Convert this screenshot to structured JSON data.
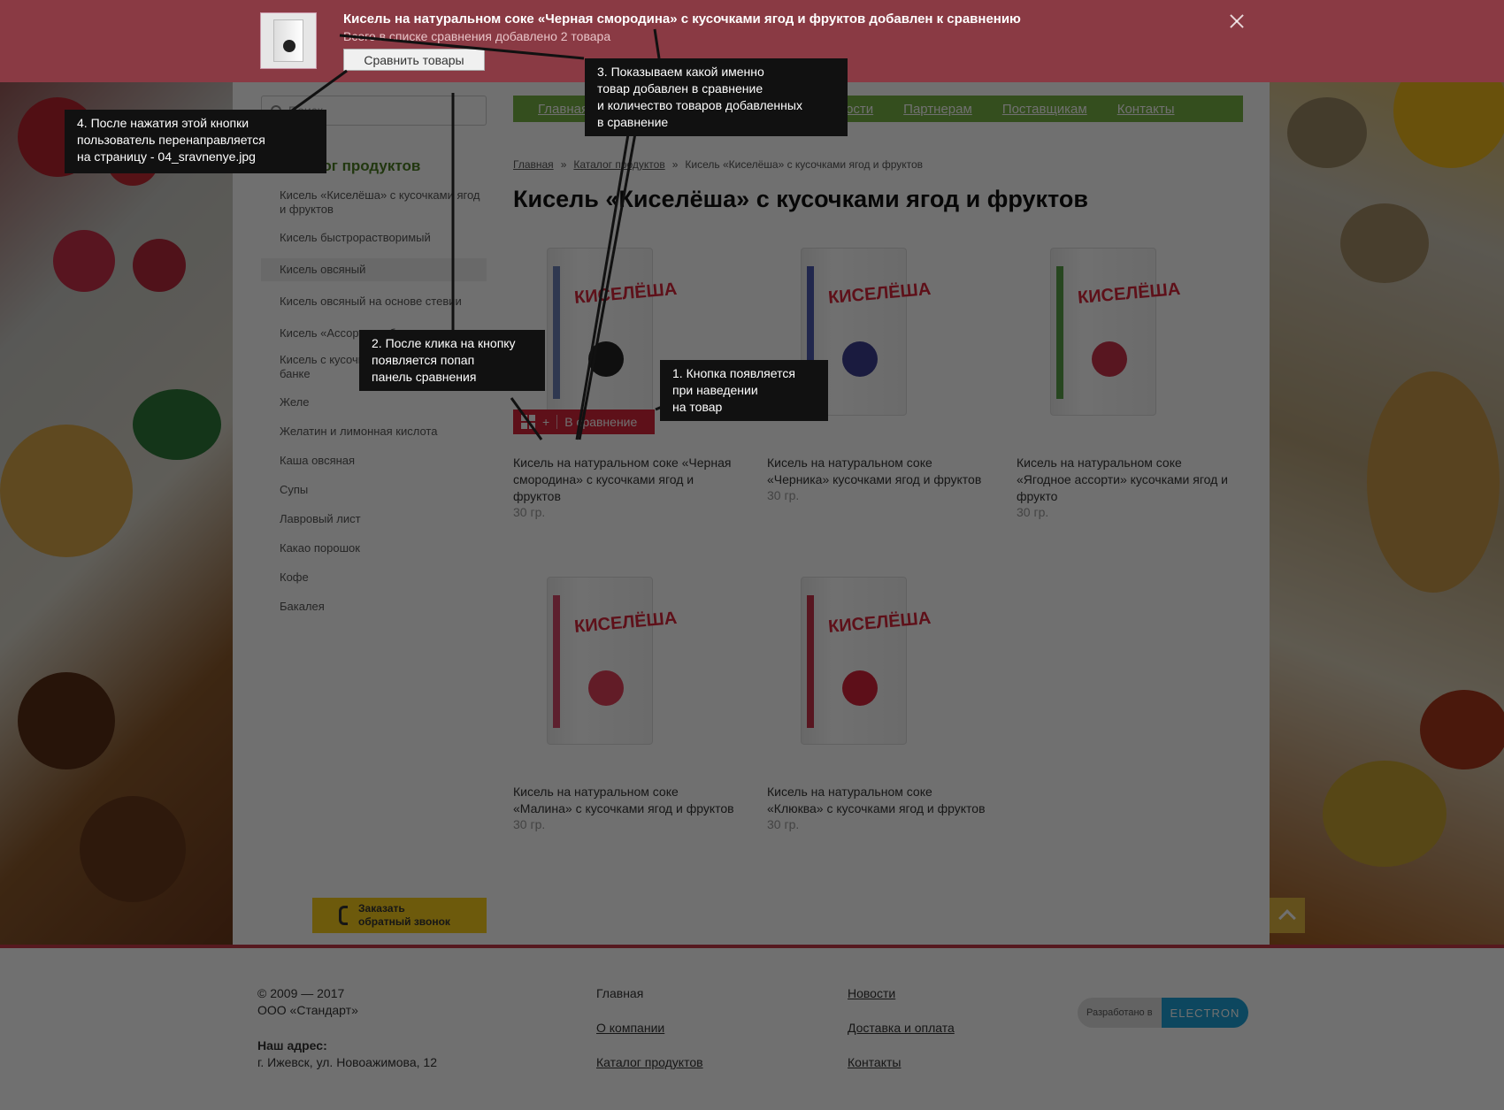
{
  "popup": {
    "title": "Кисель на натуральном соке «Черная смородина» с кусочками ягод и фруктов добавлен к сравнению",
    "subtitle": "Всего в списке сравнения добавлено 2 товара",
    "compare_button": "Сравнить товары"
  },
  "search": {
    "placeholder": "Поиск"
  },
  "nav": {
    "items": [
      "Главная",
      "Новости",
      "Партнерам",
      "Поставщикам",
      "Контакты"
    ]
  },
  "sidebar": {
    "title": "Каталог продуктов",
    "items": [
      "Кисель «Киселёша» с кусочками ягод и фруктов",
      "Кисель быстрорастворимый",
      "Кисель овсяный",
      "Кисель овсяный на основе стевии",
      "Кисель «Ассорти» в банке",
      "Кисель с кусочками ягод и фруктов в банке",
      "Желе",
      "Желатин и лимонная кислота",
      "Каша овсяная",
      "Супы",
      "Лавровый лист",
      "Какао порошок",
      "Кофе",
      "Бакалея"
    ],
    "callback_line1": "Заказать",
    "callback_line2": "обратный звонок"
  },
  "breadcrumb": {
    "items": [
      "Главная",
      "Каталог продуктов",
      "Кисель «Киселёша» с кусочками ягод и фруктов"
    ],
    "separator": "»"
  },
  "main": {
    "title": "Кисель «Киселёша» с кусочками ягод и фруктов",
    "compare_label": "В сравнение",
    "products": [
      {
        "name": "Кисель на натуральном соке «Черная смородина» с кусочками ягод и фруктов",
        "weight": "30 гр.",
        "brand": "КИСЕЛЁША",
        "color": "#222222"
      },
      {
        "name": "Кисель на натуральном соке «Черника» кусочками ягод и фруктов",
        "weight": "30 гр.",
        "brand": "КИСЕЛЁША",
        "color": "#3b3f8f"
      },
      {
        "name": "Кисель на натуральном соке «Ягодное ассорти» кусочками ягод и фрукто",
        "weight": "30 гр.",
        "brand": "КИСЕЛЁША",
        "color": "#c8344a"
      },
      {
        "name": "Кисель на натуральном соке «Малина» с кусочками ягод и фруктов",
        "weight": "30 гр.",
        "brand": "КИСЕЛЁША",
        "color": "#e0405a"
      },
      {
        "name": "Кисель на натуральном соке «Клюква» с кусочками ягод и фруктов",
        "weight": "30 гр.",
        "brand": "КИСЕЛЁША",
        "color": "#d3243a"
      }
    ]
  },
  "footer": {
    "copyright": "© 2009 — 2017",
    "company": "ООО «Стандарт»",
    "address_label": "Наш адрес:",
    "address": "г. Ижевск, ул. Новоажимова, 12",
    "col2": [
      "Главная",
      "О компании",
      "Каталог продуктов"
    ],
    "col3": [
      "Новости",
      "Доставка и оплата",
      "Контакты"
    ],
    "dev_label": "Разработано в",
    "dev_logo": "ELECTRON"
  },
  "notes": {
    "n1": [
      "1. Кнопка появляется",
      "при наведении",
      "на товар"
    ],
    "n2": [
      "2. После клика на кнопку",
      "появляется попап",
      "панель сравнения"
    ],
    "n3": [
      "3. Показываем какой именно",
      "товар добавлен в сравнение",
      "и количество товаров добавленных",
      "в сравнение"
    ],
    "n4": [
      "4. После нажатия этой кнопки",
      "пользователь перенаправляется",
      "на страницу - 04_sravnenye.jpg"
    ]
  },
  "colors": {
    "accent_red": "#d6263a",
    "nav_green": "#78b245",
    "popup_bg": "#8a3a44",
    "callback_yellow": "#f7cd1c"
  }
}
